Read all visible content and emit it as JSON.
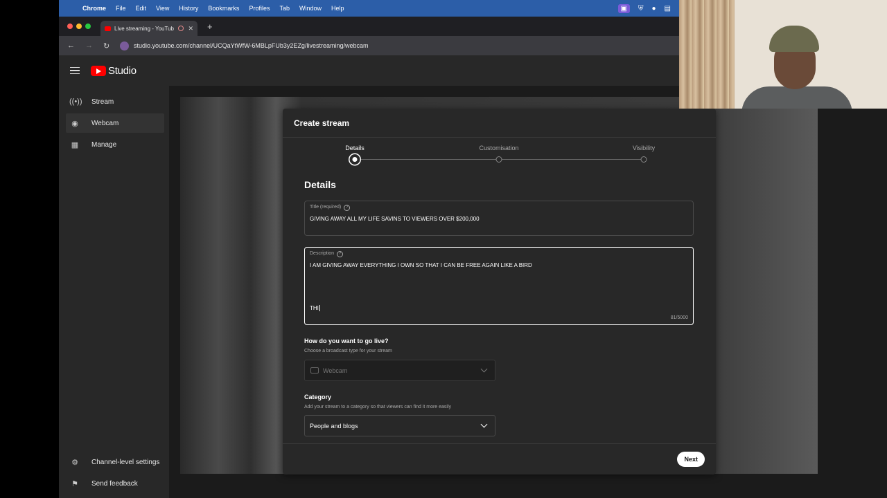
{
  "menubar": {
    "app": "Chrome",
    "items": [
      "File",
      "Edit",
      "View",
      "History",
      "Bookmarks",
      "Profiles",
      "Tab",
      "Window",
      "Help"
    ]
  },
  "browser": {
    "tab_title": "Live streaming - YouTube",
    "url": "studio.youtube.com/channel/UCQaYtWfW-6MBLpFUb3y2EZg/livestreaming/webcam"
  },
  "studio": {
    "logo_text": "Studio",
    "sidebar": {
      "items": [
        {
          "label": "Stream",
          "icon": "broadcast-icon"
        },
        {
          "label": "Webcam",
          "icon": "camera-icon"
        },
        {
          "label": "Manage",
          "icon": "calendar-icon"
        }
      ],
      "bottom": [
        {
          "label": "Channel-level settings",
          "icon": "gear-icon"
        },
        {
          "label": "Send feedback",
          "icon": "feedback-icon"
        }
      ]
    }
  },
  "dialog": {
    "title": "Create stream",
    "steps": [
      {
        "label": "Details",
        "active": true
      },
      {
        "label": "Customisation",
        "active": false
      },
      {
        "label": "Visibility",
        "active": false
      }
    ],
    "section_heading": "Details",
    "title_field": {
      "label": "Title (required)",
      "value": "GIVING AWAY ALL MY LIFE SAVINS TO VIEWERS OVER $200,000"
    },
    "description_field": {
      "label": "Description",
      "line1": "I AM GIVING AWAY EVERYTHING I OWN SO THAT I CAN BE FREE AGAIN LIKE A BIRD",
      "line2": "THI",
      "counter": "81/5000"
    },
    "go_live": {
      "heading": "How do you want to go live?",
      "sub": "Choose a broadcast type for your stream",
      "selected": "Webcam"
    },
    "category": {
      "heading": "Category",
      "sub": "Add your stream to a category so that viewers can find it more easily",
      "selected": "People and blogs"
    },
    "next_label": "Next"
  },
  "colors": {
    "menubar": "#2c5ea8",
    "youtube_red": "#ff0000",
    "dialog_bg": "#282828"
  }
}
